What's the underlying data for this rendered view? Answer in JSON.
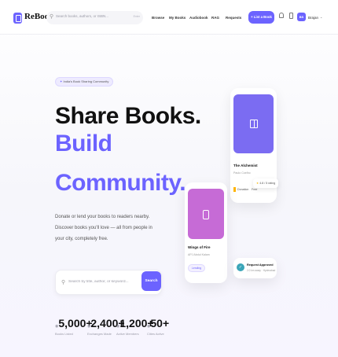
{
  "brand": {
    "name": "ReBook"
  },
  "nav": {
    "search_placeholder": "Search books, authors, or ISBN...",
    "search_hint": "Enter",
    "links": [
      "Browse",
      "My Books",
      "Audiobook",
      "RAG",
      "Requests"
    ],
    "list_book_label": "+ List a Book",
    "user": {
      "initials": "BS",
      "name": "Brajan"
    }
  },
  "hero": {
    "badge": "India's Book Sharing Community",
    "headline_line1": "Share Books.",
    "headline_line2": "Build",
    "headline_line3": "Community.",
    "lede": "Donate or lend your books to readers nearby. Discover books you'll love — all from people in your city, completely free.",
    "search_placeholder": "Search by title, author, or keyword...",
    "search_button": "Search"
  },
  "stats": [
    {
      "value": "5,000+",
      "label": "Books Listed"
    },
    {
      "value": "2,400+",
      "label": "Exchanges Made"
    },
    {
      "value": "1,200+",
      "label": "Active Members"
    },
    {
      "value": "50+",
      "label": "Cities Active"
    }
  ],
  "cards": {
    "alchemist": {
      "title": "The Alchemist",
      "author": "Paulo Coelho",
      "tag": "Donation",
      "tag2": "Free"
    },
    "rating": "4.8 / 5 rating",
    "wings": {
      "title": "Wings of Fire",
      "author": "APJ Abdul Kalam",
      "status": "Lending"
    },
    "request": {
      "title": "Request Approved",
      "subtitle": "2.0 km away · Hyderabad"
    }
  },
  "colors": {
    "accent": "#6c63ff",
    "alchemist_cover": "#7b6cf2",
    "wings_cover": "#c66bd6",
    "request_icon": "#3aa5b8",
    "star": "#f5b300"
  },
  "icons": {
    "logo": "book-icon",
    "search": "search-icon",
    "bell": "bell-icon",
    "bag": "shopping-bag-icon",
    "chevron": "chevron-down-icon",
    "book_cover": "open-book-icon",
    "phone_cover": "phone-icon",
    "request": "check-circle-icon"
  }
}
